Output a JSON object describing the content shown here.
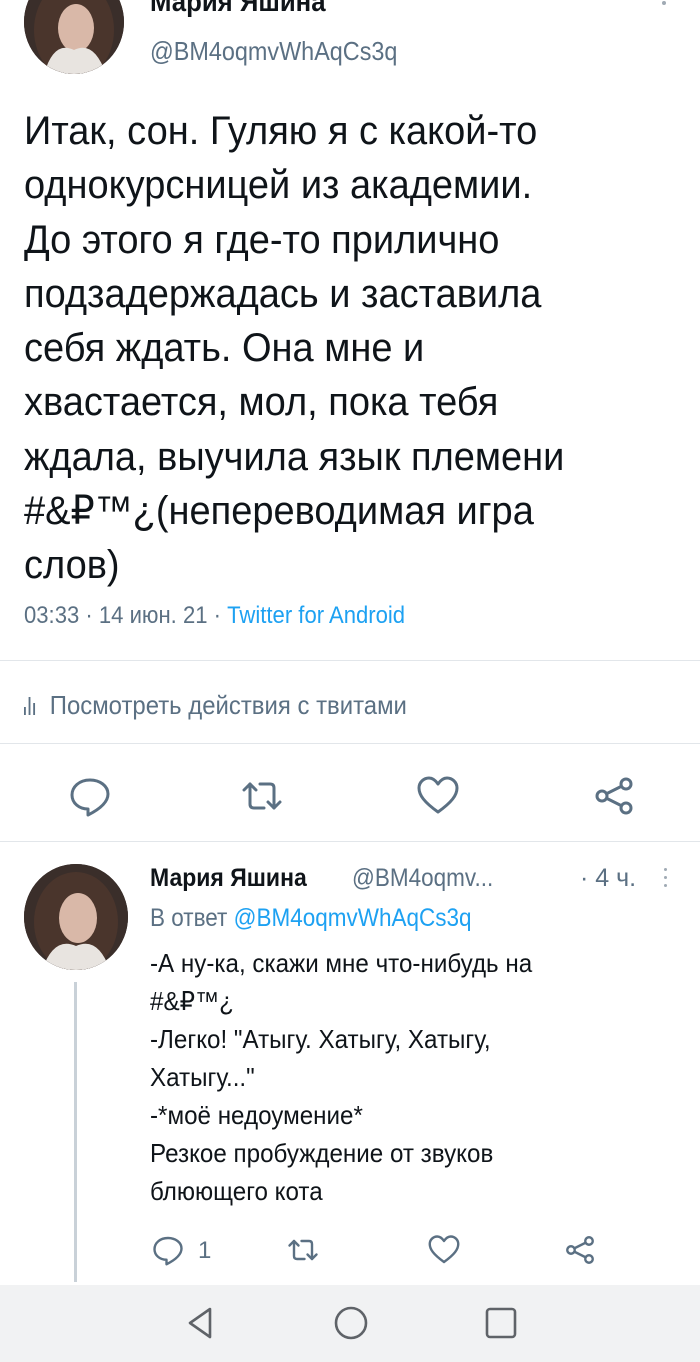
{
  "main_tweet": {
    "author_name": "Мария Яшина",
    "handle": "@BM4oqmvWhAqCs3q",
    "text": "Итак, сон. Гуляю я с какой-то\nоднокурсницей из академии.\nДо этого я где-то прилично\nподзадержадась и заставила\nсебя ждать. Она мне и\nхвастается, мол, пока тебя\nждала, выучила язык племени\n#&₽™¿(непереводимая игра\nслов)",
    "time": "03:33",
    "date": "14 июн. 21",
    "separator": "·",
    "client": "Twitter for Android",
    "activity_label": "Посмотреть действия с твитами",
    "actions": [
      "reply-icon",
      "retweet-icon",
      "like-icon",
      "share-icon"
    ]
  },
  "reply_tweet": {
    "author_name": "Мария Яшина",
    "handle": "@BM4oqmv...",
    "time": "· 4 ч.",
    "reply_prefix": "В ответ",
    "reply_mention": "@BM4oqmvWhAqCs3q",
    "text": "-А ну-ка, скажи мне что-нибудь на\n#&₽™¿\n-Легко! \"Атыгу. Хатыгу, Хатыгу,\nХатыгу...\"\n-*моё недоумение*\nРезкое пробуждение от звуков\nблюющего кота",
    "reply_count": "1",
    "actions": [
      "reply-icon",
      "retweet-icon",
      "like-icon",
      "share-icon"
    ]
  },
  "navbar": {
    "buttons": [
      "back-triangle-icon",
      "home-circle-icon",
      "recents-square-icon"
    ]
  },
  "colors": {
    "text": "#0f1419",
    "secondary": "#5b7083",
    "accent": "#1da1f2",
    "divider": "#e2e6ea",
    "navbar_bg": "#f1f2f3"
  }
}
